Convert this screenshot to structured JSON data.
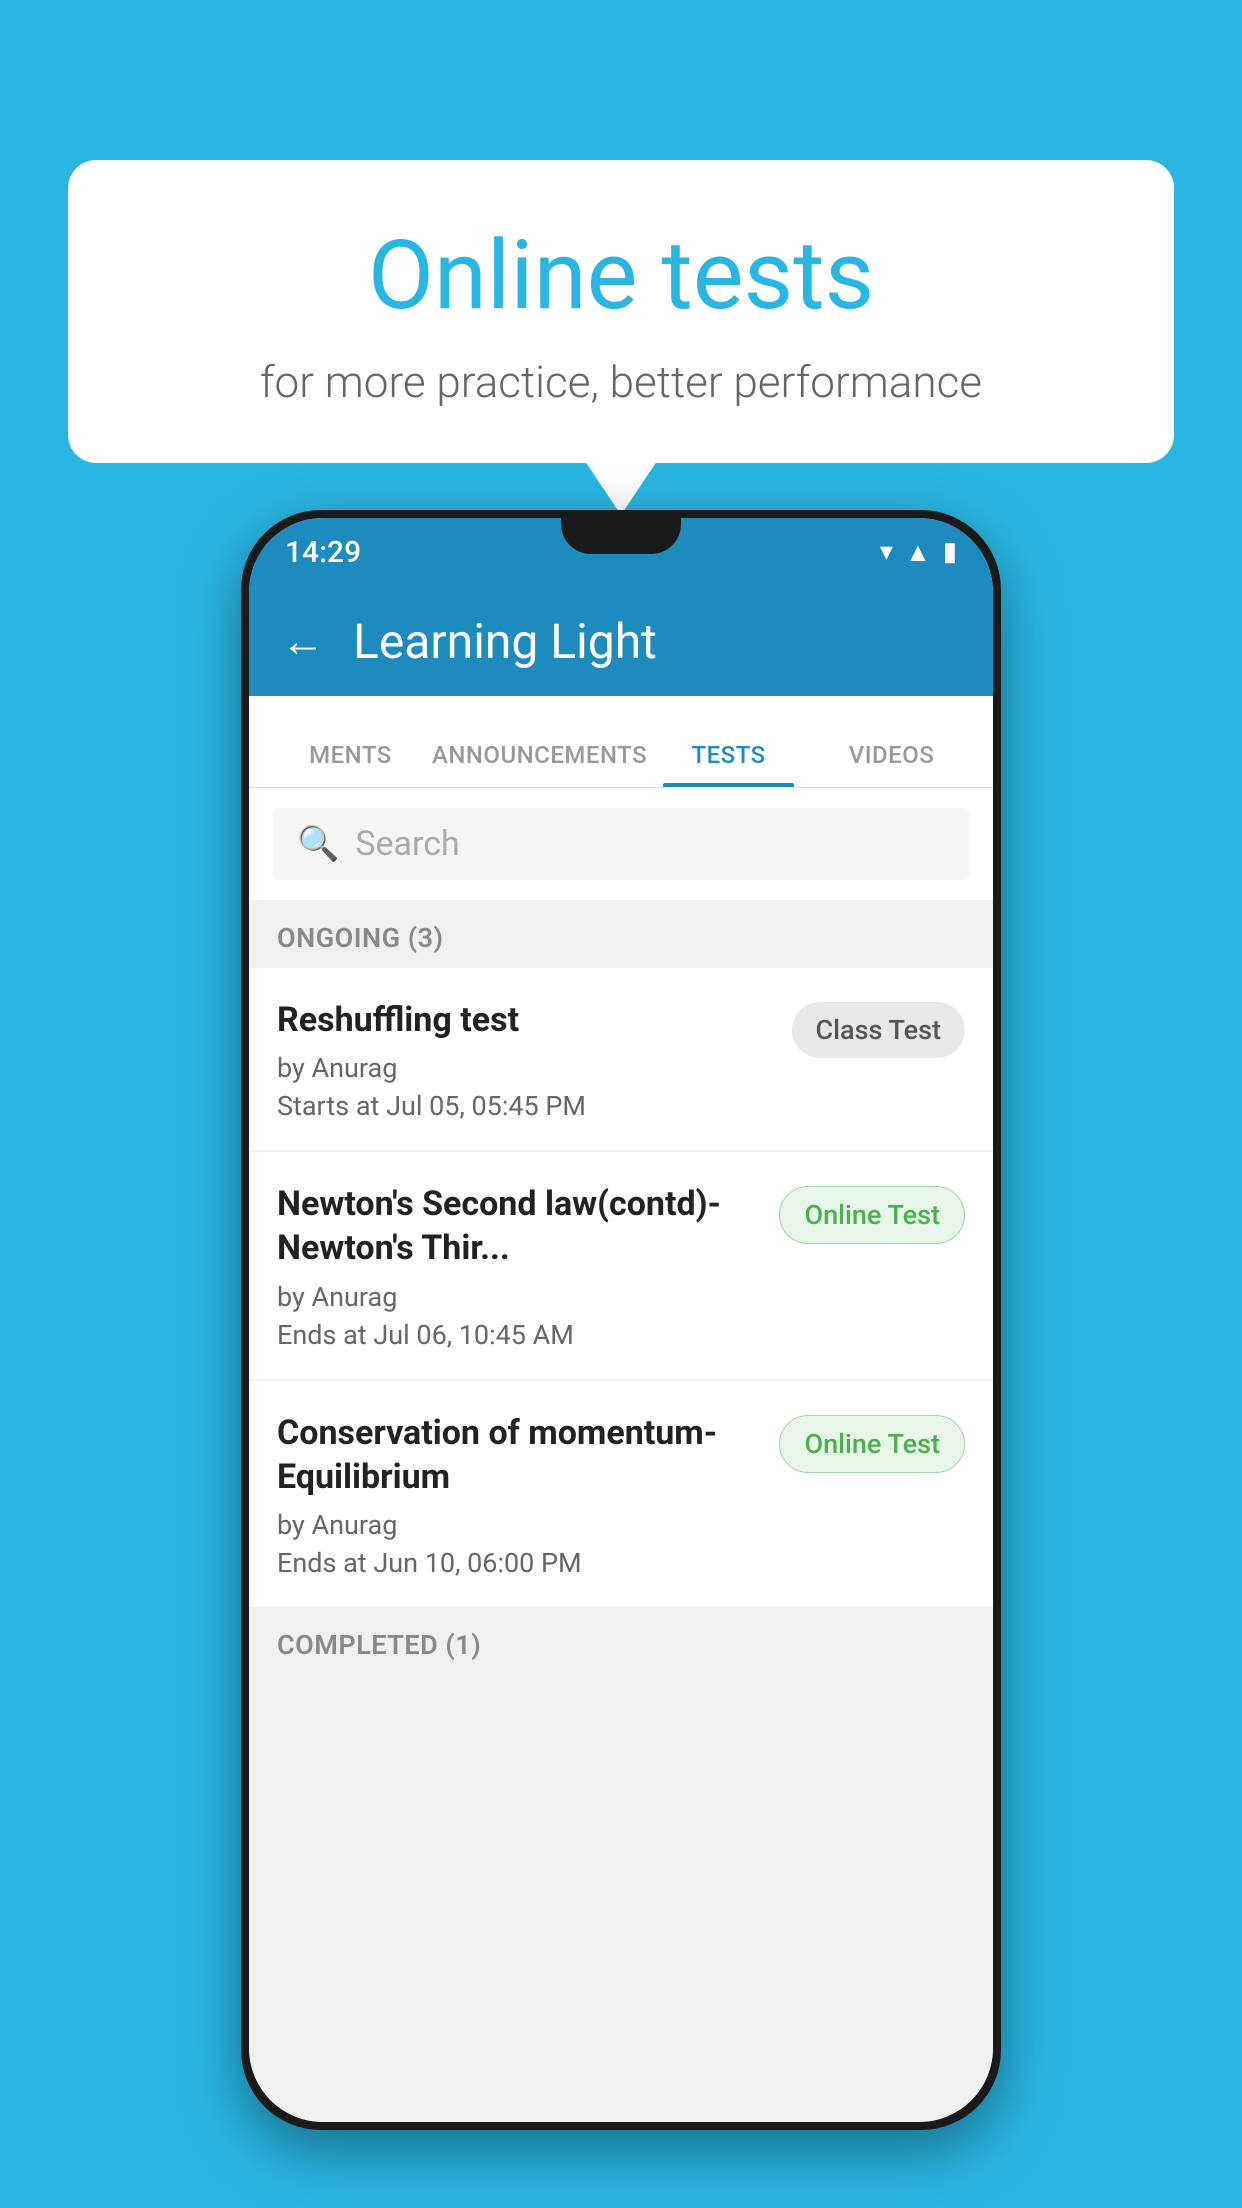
{
  "background": {
    "color": "#29b6e3"
  },
  "speech_bubble": {
    "title": "Online tests",
    "subtitle": "for more practice, better performance"
  },
  "phone": {
    "status_bar": {
      "time": "14:29",
      "icons": [
        "wifi",
        "signal",
        "battery"
      ]
    },
    "app_bar": {
      "title": "Learning Light",
      "back_label": "←"
    },
    "tabs": [
      {
        "label": "MENTS",
        "active": false
      },
      {
        "label": "ANNOUNCEMENTS",
        "active": false
      },
      {
        "label": "TESTS",
        "active": true
      },
      {
        "label": "VIDEOS",
        "active": false
      }
    ],
    "search": {
      "placeholder": "Search"
    },
    "ongoing_section": {
      "title": "ONGOING (3)",
      "tests": [
        {
          "name": "Reshuffling test",
          "author": "by Anurag",
          "time_label": "Starts at",
          "time": "Jul 05, 05:45 PM",
          "badge": "Class Test",
          "badge_type": "class"
        },
        {
          "name": "Newton's Second law(contd)-Newton's Thir...",
          "author": "by Anurag",
          "time_label": "Ends at",
          "time": "Jul 06, 10:45 AM",
          "badge": "Online Test",
          "badge_type": "online"
        },
        {
          "name": "Conservation of momentum-Equilibrium",
          "author": "by Anurag",
          "time_label": "Ends at",
          "time": "Jun 10, 06:00 PM",
          "badge": "Online Test",
          "badge_type": "online"
        }
      ]
    },
    "completed_section": {
      "title": "COMPLETED (1)"
    }
  }
}
